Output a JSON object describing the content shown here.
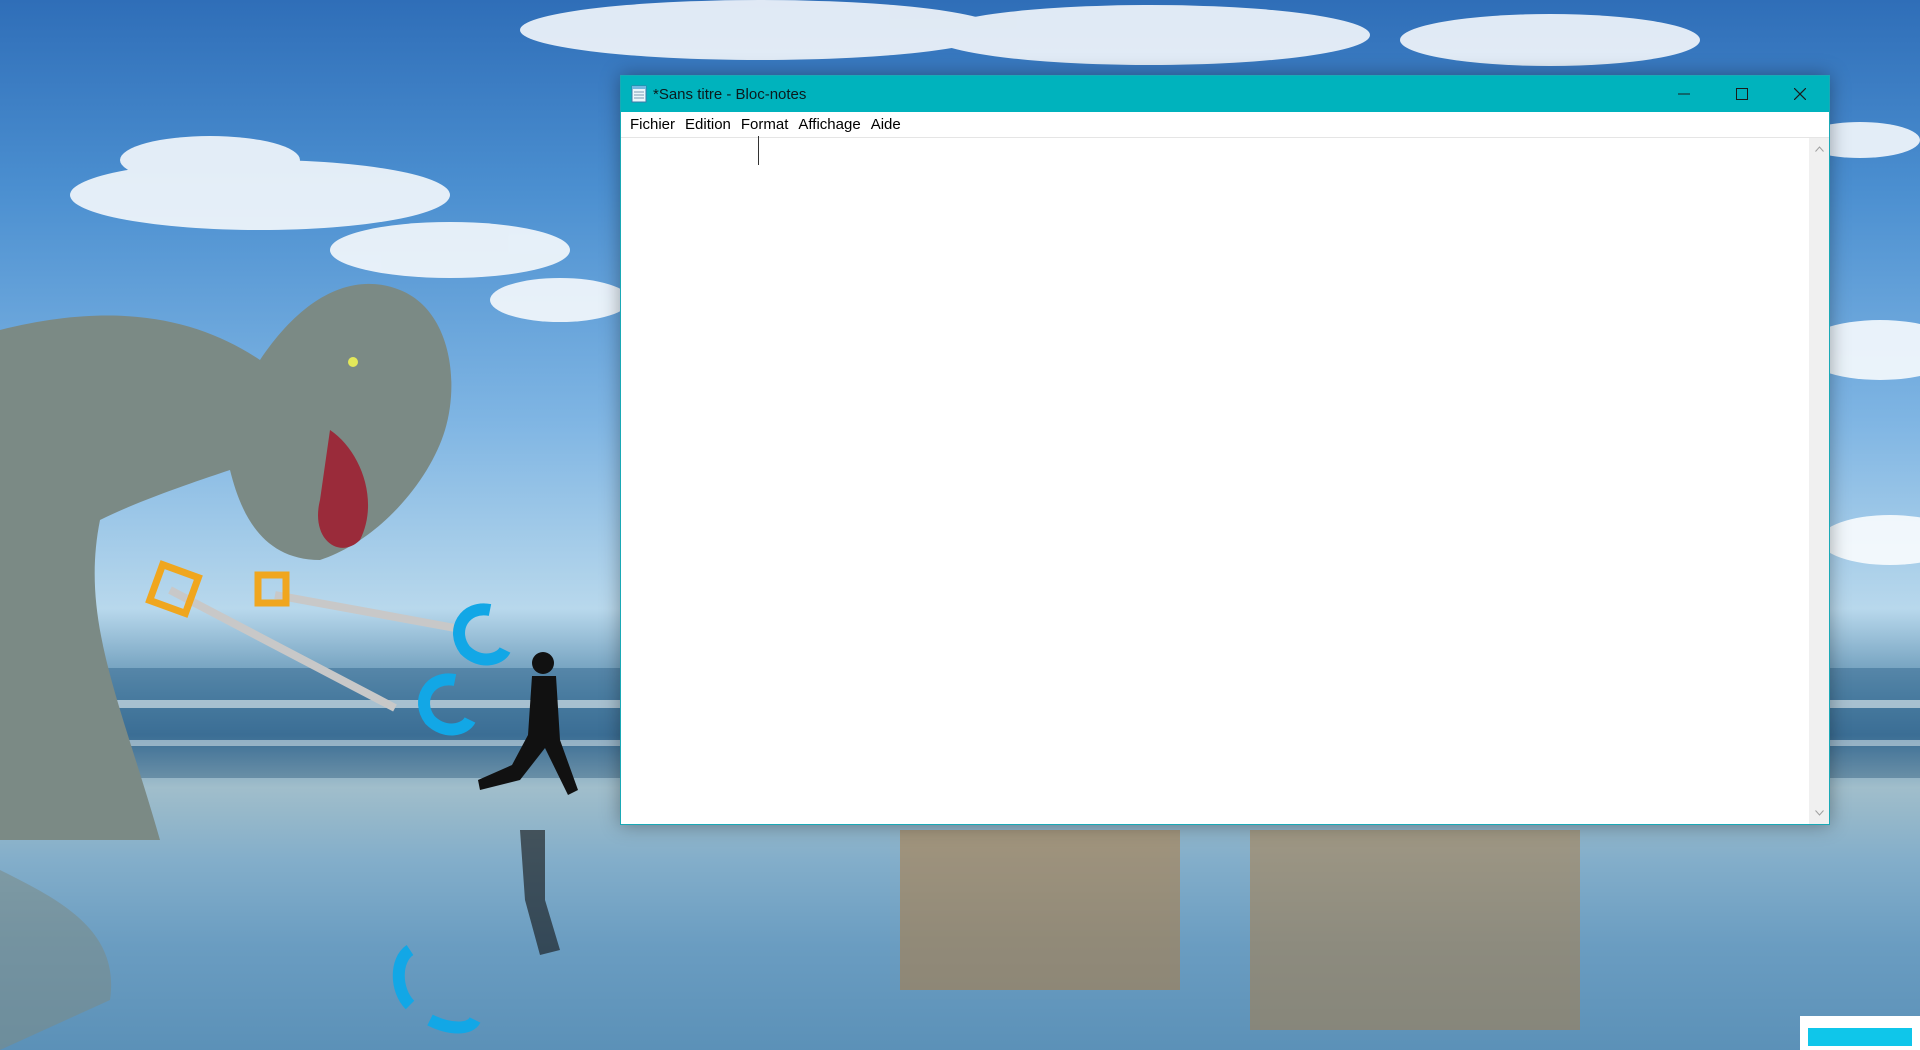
{
  "window": {
    "title": "*Sans titre - Bloc-notes",
    "app_icon": "notepad-icon",
    "accent_color": "#00b3bd",
    "caption_buttons": [
      "minimize-icon",
      "maximize-icon",
      "close-icon"
    ]
  },
  "menubar": {
    "items": [
      "Fichier",
      "Edition",
      "Format",
      "Affichage",
      "Aide"
    ]
  },
  "editor": {
    "content": ""
  },
  "scrollbar": {
    "up_icon": "chevron-up-icon",
    "down_icon": "chevron-down-icon"
  },
  "wallpaper": {
    "description_icons": [
      "sky",
      "clouds",
      "dinosaur",
      "runner",
      "beach"
    ]
  }
}
